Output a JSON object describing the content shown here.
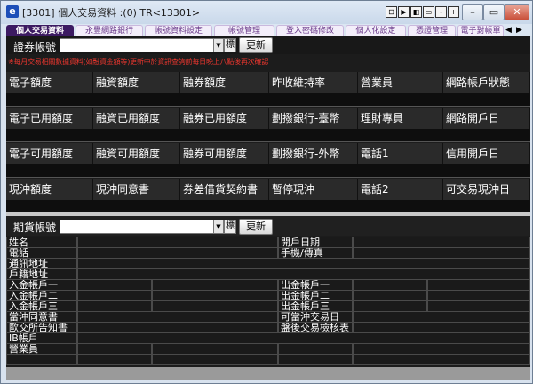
{
  "window": {
    "title": "[3301] 個人交易資料 :(0) TR<13301>",
    "app_icon": "e",
    "toolbar_glyphs": [
      "⊡",
      "▶",
      "◧",
      "▭",
      "-",
      "+"
    ],
    "controls": {
      "minimize": "–",
      "restore": "▭",
      "close": "✕"
    }
  },
  "tabs": [
    "個人交易資料",
    "永豐網路銀行",
    "帳號資料設定",
    "帳號管理",
    "登入密碼修改",
    "個人化設定",
    "憑證管理",
    "電子對帳單"
  ],
  "tab_nav": {
    "prev": "◀",
    "next": "▶"
  },
  "securities": {
    "label": "證券帳號",
    "input_value": "",
    "dropdown": "▼",
    "extra": "標",
    "refresh": "更新"
  },
  "warning": "※每月交易相關數據資料(如融資金額等)更新中於資訊查詢前每日晚上八點後再次確認",
  "stock_rows": [
    [
      "電子額度",
      "融資額度",
      "融券額度",
      "昨收維持率",
      "營業員",
      "網路帳戶狀態"
    ],
    [
      "電子已用額度",
      "融資已用額度",
      "融券已用額度",
      "劃撥銀行-臺幣",
      "理財專員",
      "網路開戶日"
    ],
    [
      "電子可用額度",
      "融資可用額度",
      "融券可用額度",
      "劃撥銀行-外幣",
      "電話1",
      "信用開戶日"
    ],
    [
      "現沖額度",
      "現沖同意書",
      "券差借貨契約書",
      "暫停現沖",
      "電話2",
      "可交易現沖日"
    ]
  ],
  "futures": {
    "label": "期貨帳號",
    "input_value": "",
    "dropdown": "▼",
    "extra": "標",
    "refresh": "更新"
  },
  "futures_rows": [
    {
      "left": "姓名",
      "right": "開戶日期"
    },
    {
      "left": "電話",
      "right": "手機/傳真"
    },
    {
      "left": "通訊地址",
      "right": ""
    },
    {
      "left": "戶籍地址",
      "right": ""
    },
    {
      "left": "入金帳戶一",
      "right": "出金帳戶一"
    },
    {
      "left": "入金帳戶二",
      "right": "出金帳戶二"
    },
    {
      "left": "入金帳戶三",
      "right": "出金帳戶三"
    },
    {
      "left": "當沖同意書",
      "right": "可當沖交易日"
    },
    {
      "left": "歐交所告知書",
      "right": "盤後交易檢核表"
    },
    {
      "left": "IB帳戶",
      "right": ""
    },
    {
      "left": "營業員",
      "right": ""
    }
  ]
}
